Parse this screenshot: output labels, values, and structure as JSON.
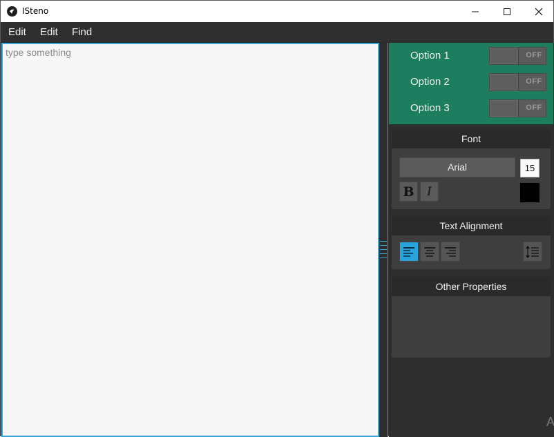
{
  "window": {
    "title": "ISteno",
    "icon": "kivy-logo-icon"
  },
  "menu": {
    "items": [
      {
        "label": "Edit"
      },
      {
        "label": "Edit"
      },
      {
        "label": "Find"
      }
    ]
  },
  "editor": {
    "placeholder": "type something",
    "value": ""
  },
  "options": {
    "items": [
      {
        "label": "Option 1",
        "state": "OFF"
      },
      {
        "label": "Option 2",
        "state": "OFF"
      },
      {
        "label": "Option 3",
        "state": "OFF"
      }
    ],
    "panel_color": "#1d7d5f"
  },
  "font": {
    "header": "Font",
    "family": "Arial",
    "size": "15",
    "bold_label": "B",
    "italic_label": "I",
    "color": "#000000"
  },
  "alignment": {
    "header": "Text Alignment",
    "selected": "left",
    "accent": "#29a3dc"
  },
  "other": {
    "header": "Other Properties"
  },
  "watermark": {
    "text": "A"
  }
}
